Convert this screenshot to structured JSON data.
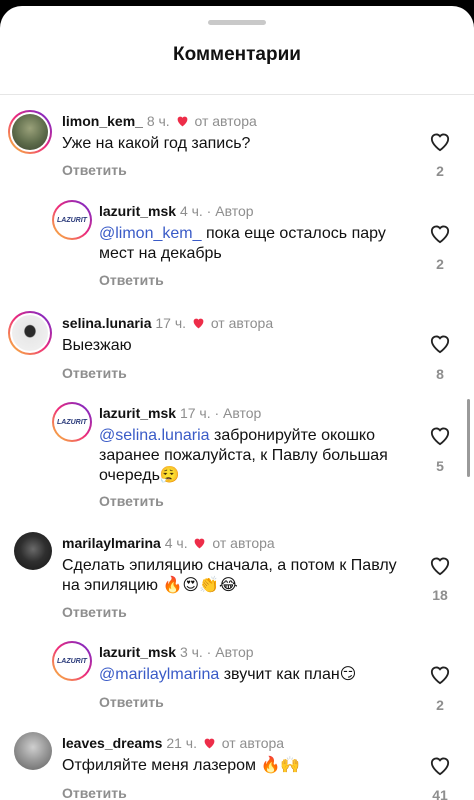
{
  "header": {
    "title": "Комментарии"
  },
  "reply_label": "Ответить",
  "comments": [
    {
      "user": "limon_kem_",
      "time": "8 ч.",
      "badge": "от автора",
      "text": "Уже на какой год запись?",
      "likes": "2"
    },
    {
      "user": "lazurit_msk",
      "time": "4 ч.",
      "badge": "Автор",
      "mention": "@limon_kem_",
      "text": " пока еще осталось пару мест на декабрь",
      "likes": "2"
    },
    {
      "user": "selina.lunaria",
      "time": "17 ч.",
      "badge": "от автора",
      "text": "Выезжаю",
      "likes": "8"
    },
    {
      "user": "lazurit_msk",
      "time": "17 ч.",
      "badge": "Автор",
      "mention": "@selina.lunaria",
      "text": " забронируйте окошко заранее пожалуйста, к Павлу большая очередь😮‍💨",
      "likes": "5"
    },
    {
      "user": "marilaylmarina",
      "time": "4 ч.",
      "badge": "от автора",
      "text": "Сделать эпиляцию сначала, а потом к Павлу на эпиляцию 🔥😍👏😂",
      "likes": "18"
    },
    {
      "user": "lazurit_msk",
      "time": "3 ч.",
      "badge": "Автор",
      "mention": "@marilaylmarina",
      "text": " звучит как план😏",
      "likes": "2"
    },
    {
      "user": "leaves_dreams",
      "time": "21 ч.",
      "badge": "от автора",
      "text": "Отфиляйте меня лазером 🔥🙌",
      "likes": "41"
    }
  ],
  "logo_text": "LAZURIT",
  "colors": {
    "accent_red": "#ed2d49",
    "mention": "#3a5bc7",
    "muted": "#8e8e8e"
  }
}
